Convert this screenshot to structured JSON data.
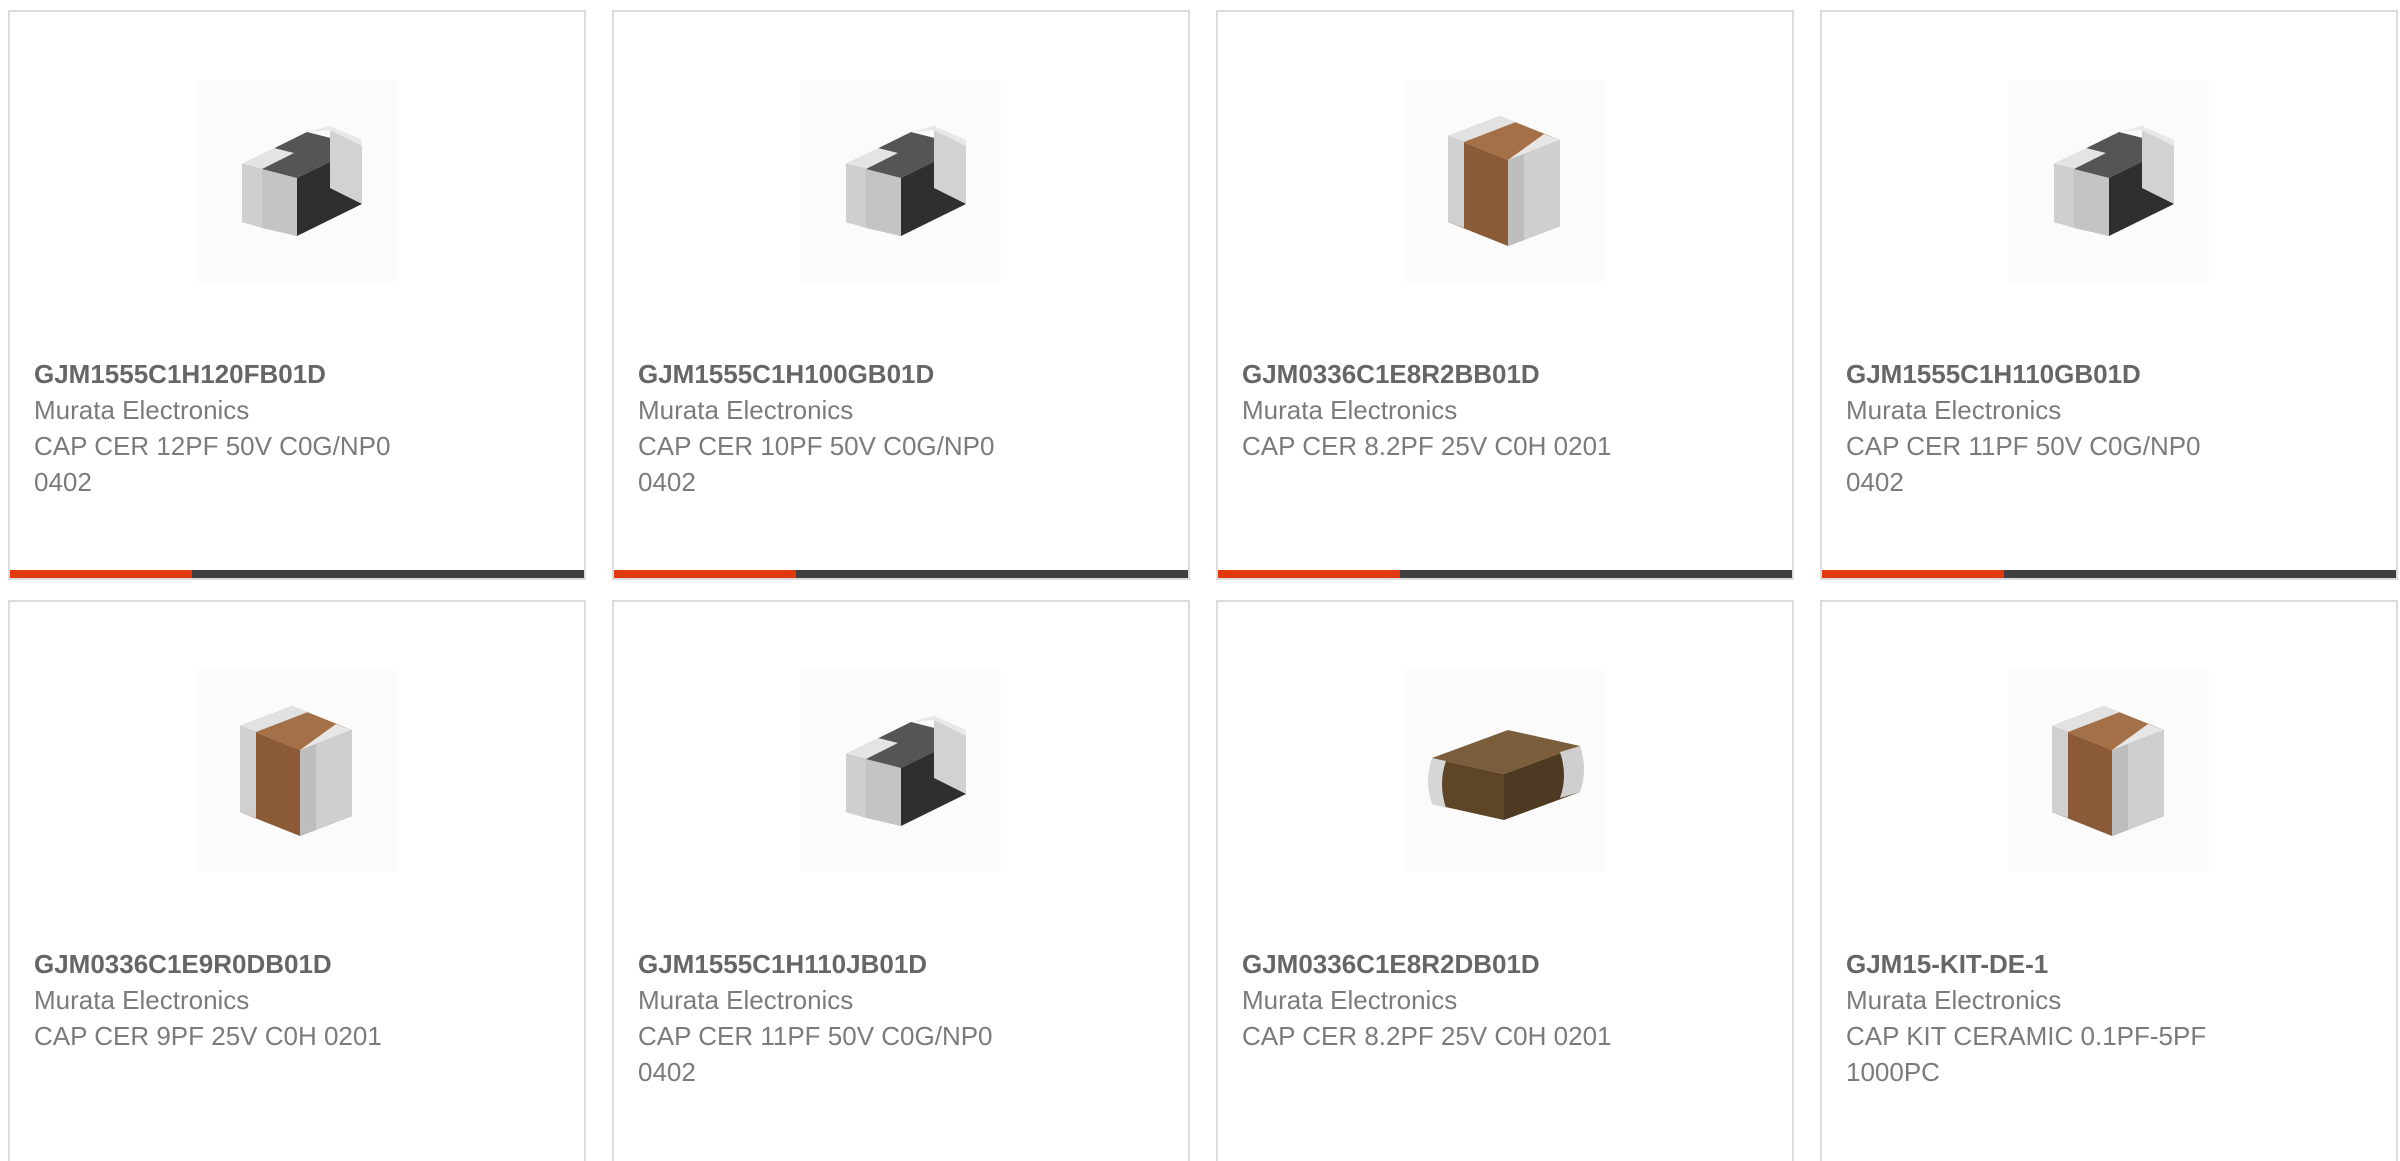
{
  "products": [
    {
      "part_number": "GJM1555C1H120FB01D",
      "manufacturer": "Murata Electronics",
      "description": "CAP CER 12PF 50V C0G/NP0 0402",
      "image_icon": "mlcc-chip-gray-icon"
    },
    {
      "part_number": "GJM1555C1H100GB01D",
      "manufacturer": "Murata Electronics",
      "description": "CAP CER 10PF 50V C0G/NP0 0402",
      "image_icon": "mlcc-chip-gray-icon"
    },
    {
      "part_number": "GJM0336C1E8R2BB01D",
      "manufacturer": "Murata Electronics",
      "description": "CAP CER 8.2PF 25V C0H 0201",
      "image_icon": "mlcc-chip-brown-icon"
    },
    {
      "part_number": "GJM1555C1H110GB01D",
      "manufacturer": "Murata Electronics",
      "description": "CAP CER 11PF 50V C0G/NP0 0402",
      "image_icon": "mlcc-chip-gray-icon"
    },
    {
      "part_number": "GJM0336C1E9R0DB01D",
      "manufacturer": "Murata Electronics",
      "description": "CAP CER 9PF 25V C0H 0201",
      "image_icon": "mlcc-chip-brown-icon"
    },
    {
      "part_number": "GJM1555C1H110JB01D",
      "manufacturer": "Murata Electronics",
      "description": "CAP CER 11PF 50V C0G/NP0 0402",
      "image_icon": "mlcc-chip-gray-icon"
    },
    {
      "part_number": "GJM0336C1E8R2DB01D",
      "manufacturer": "Murata Electronics",
      "description": "CAP CER 8.2PF 25V C0H 0201",
      "image_icon": "mlcc-chip-flat-brown-icon"
    },
    {
      "part_number": "GJM15-KIT-DE-1",
      "manufacturer": "Murata Electronics",
      "description": "CAP KIT CERAMIC 0.1PF-5PF 1000PC",
      "image_icon": "mlcc-chip-brown-icon"
    }
  ],
  "colors": {
    "accent": "#e23a10",
    "bar": "#3f3f3f",
    "text_bold": "#666666",
    "text": "#7b7b7b",
    "border": "#dcdcdc",
    "chip_gray_body": "#3a3a3a",
    "chip_brown_body": "#8b5a36",
    "chip_terminal": "#d9d9d9"
  }
}
